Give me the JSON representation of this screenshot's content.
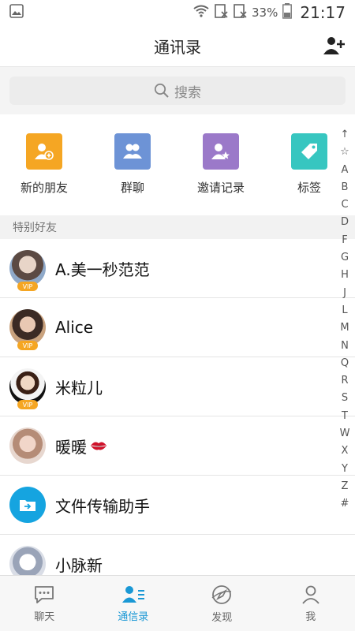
{
  "status": {
    "battery": "33%",
    "time": "21:17"
  },
  "header": {
    "title": "通讯录"
  },
  "search": {
    "placeholder": "搜索"
  },
  "quick_actions": [
    {
      "label": "新的朋友",
      "icon": "add-friend-icon",
      "color": "#f5a623"
    },
    {
      "label": "群聊",
      "icon": "group-icon",
      "color": "#6d93d6"
    },
    {
      "label": "邀请记录",
      "icon": "invite-icon",
      "color": "#9b79c9"
    },
    {
      "label": "标签",
      "icon": "tag-icon",
      "color": "#37c6c0"
    }
  ],
  "section": {
    "title": "特别好友"
  },
  "contacts": [
    {
      "name": "A.美一秒范范",
      "vip": "VIP"
    },
    {
      "name": "Alice",
      "vip": "VIP"
    },
    {
      "name": "米粒儿",
      "vip": "VIP"
    },
    {
      "name": "暖暖",
      "vip": ""
    },
    {
      "name": "文件传输助手",
      "vip": ""
    },
    {
      "name": "小脉新",
      "vip": ""
    }
  ],
  "index_letters": [
    "↑",
    "☆",
    "A",
    "B",
    "C",
    "D",
    "F",
    "G",
    "H",
    "J",
    "L",
    "M",
    "N",
    "Q",
    "R",
    "S",
    "T",
    "W",
    "X",
    "Y",
    "Z",
    "#"
  ],
  "tabs": [
    {
      "label": "聊天"
    },
    {
      "label": "通信录"
    },
    {
      "label": "发现"
    },
    {
      "label": "我"
    }
  ],
  "colors": {
    "accent": "#1a98d5",
    "vip": "#f5a623"
  }
}
